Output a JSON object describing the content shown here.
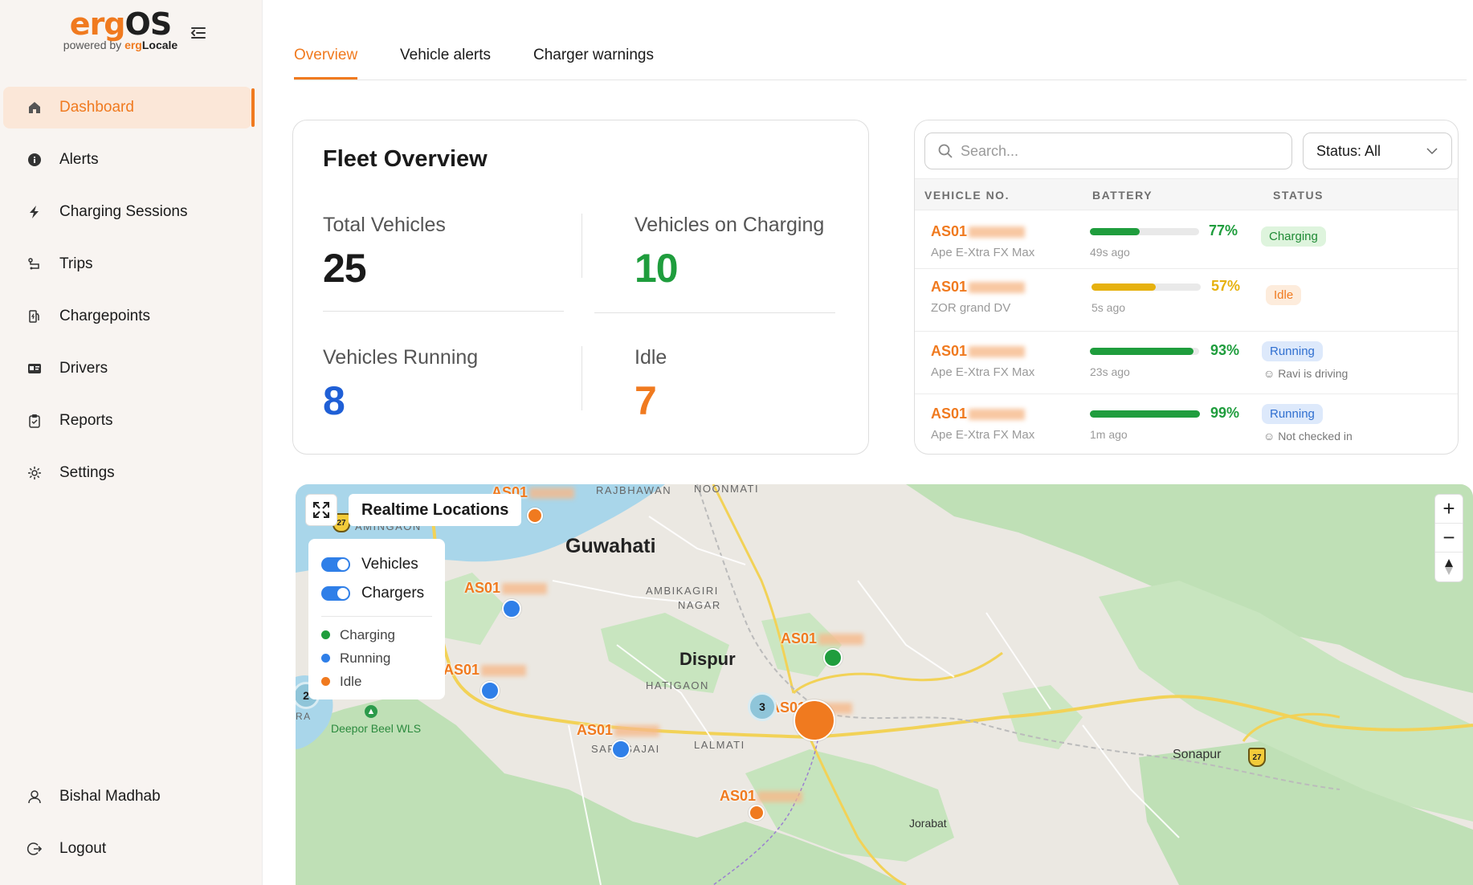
{
  "brand": {
    "name_main": "erg",
    "name_os": "OS",
    "powered_by": "powered by",
    "partner_main": "erg",
    "partner_loc": "Locale"
  },
  "sidebar": {
    "items": [
      {
        "label": "Dashboard",
        "icon": "home-icon",
        "active": true
      },
      {
        "label": "Alerts",
        "icon": "info-icon"
      },
      {
        "label": "Charging Sessions",
        "icon": "bolt-icon"
      },
      {
        "label": "Trips",
        "icon": "route-icon"
      },
      {
        "label": "Chargepoints",
        "icon": "fuel-station-icon"
      },
      {
        "label": "Drivers",
        "icon": "id-card-icon"
      },
      {
        "label": "Reports",
        "icon": "clipboard-icon"
      },
      {
        "label": "Settings",
        "icon": "gear-icon"
      }
    ],
    "user_name": "Bishal Madhab",
    "logout_label": "Logout"
  },
  "tabs": [
    {
      "label": "Overview",
      "active": true
    },
    {
      "label": "Vehicle alerts"
    },
    {
      "label": "Charger warnings"
    }
  ],
  "fleet": {
    "title": "Fleet Overview",
    "total_label": "Total Vehicles",
    "total_value": "25",
    "charging_label": "Vehicles on Charging",
    "charging_value": "10",
    "running_label": "Vehicles Running",
    "running_value": "8",
    "idle_label": "Idle",
    "idle_value": "7"
  },
  "vehicle_table": {
    "search_placeholder": "Search...",
    "status_filter": "Status: All",
    "columns": [
      "VEHICLE NO.",
      "BATTERY",
      "STATUS"
    ],
    "rows": [
      {
        "vehicle_no": "AS01",
        "model": "Ape E-Xtra FX Max",
        "battery": 77,
        "battery_label": "77%",
        "updated": "49s ago",
        "status": "Charging",
        "driver": ""
      },
      {
        "vehicle_no": "AS01",
        "model": "ZOR grand DV",
        "battery": 57,
        "battery_label": "57%",
        "updated": "5s ago",
        "status": "Idle",
        "driver": ""
      },
      {
        "vehicle_no": "AS01",
        "model": "Ape E-Xtra FX Max",
        "battery": 93,
        "battery_label": "93%",
        "updated": "23s ago",
        "status": "Running",
        "driver": "Ravi is driving"
      },
      {
        "vehicle_no": "AS01",
        "model": "Ape E-Xtra FX Max",
        "battery": 99,
        "battery_label": "99%",
        "updated": "1m ago",
        "status": "Running",
        "driver": "Not checked in"
      }
    ]
  },
  "map": {
    "title": "Realtime Locations",
    "toggles": [
      {
        "label": "Vehicles",
        "on": true
      },
      {
        "label": "Chargers",
        "on": true
      }
    ],
    "legend": [
      {
        "label": "Charging",
        "color": "#1f9d3d"
      },
      {
        "label": "Running",
        "color": "#2f7fe8"
      },
      {
        "label": "Idle",
        "color": "#f07a1f"
      }
    ],
    "places": {
      "guwahati": "Guwahati",
      "dispur": "Dispur",
      "rajbhawan": "RAJBHAWAN",
      "noonmati": "NOONMATI",
      "amingaon": "AMINGAON",
      "ambikagiri": "AMBIKAGIRI",
      "nagar": "NAGAR",
      "hatigaon": "HATIGAON",
      "sarusajai": "SARUSAJAI",
      "lalmati": "LALMATI",
      "deepor": "Deepor Beel WLS",
      "sonapur": "Sonapur",
      "jorabat": "Jorabat",
      "ra": "RA"
    },
    "vehicle_prefix": "AS01",
    "clusters": [
      "2",
      "3"
    ],
    "shields": [
      "27",
      "27",
      "27"
    ],
    "zoom_in": "+",
    "zoom_out": "−"
  },
  "colors": {
    "accent": "#f07a1f",
    "charging": "#1f9d3d",
    "running": "#2f7fe8",
    "idle": "#f07a1f",
    "battery_high": "#1f9d3d",
    "battery_mid": "#e6b10f"
  }
}
